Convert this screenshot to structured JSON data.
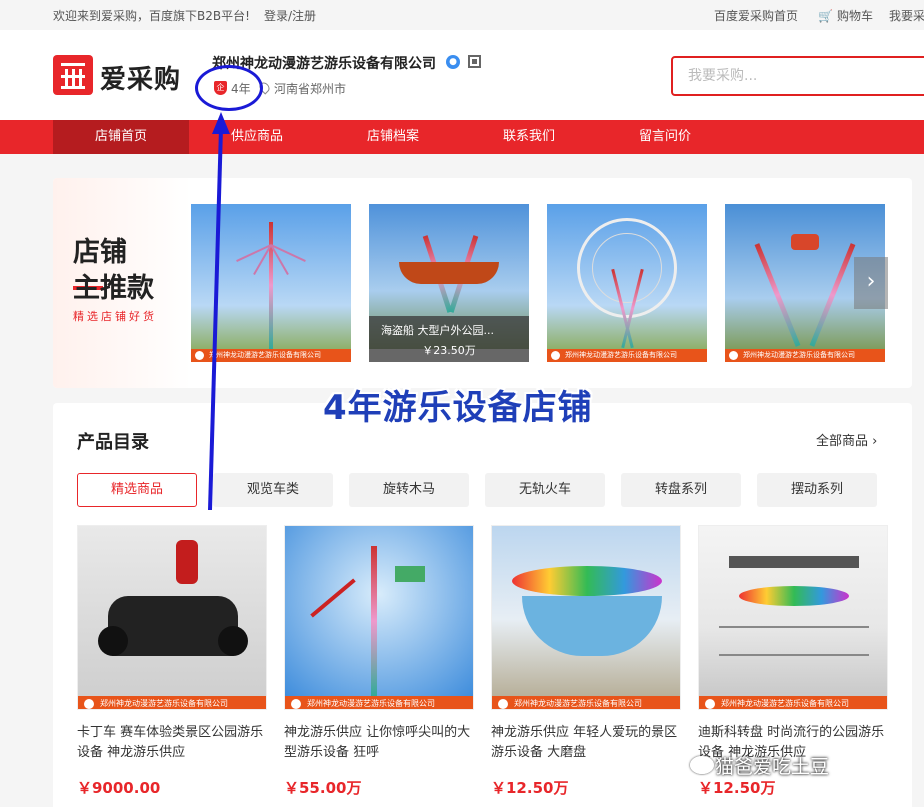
{
  "topbar": {
    "welcome": "欢迎来到爱采购，百度旗下B2B平台!",
    "login": "登录/注册",
    "home": "百度爱采购首页",
    "cart": "购物车",
    "more": "我要采购"
  },
  "header": {
    "logo_text": "爱采购",
    "shop_name": "郑州神龙动漫游艺游乐设备有限公司",
    "years": "4年",
    "location": "河南省郑州市",
    "search_placeholder": "我要采购..."
  },
  "nav": {
    "items": [
      {
        "label": "店铺首页"
      },
      {
        "label": "供应商品"
      },
      {
        "label": "店铺档案"
      },
      {
        "label": "联系我们"
      },
      {
        "label": "留言问价"
      }
    ]
  },
  "featured": {
    "title_line1": "店铺",
    "title_line2": "主推款",
    "subtitle": "精选店铺好货",
    "strip_text": "郑州神龙动漫游艺游乐设备有限公司",
    "overlay_title": "海盗船 大型户外公园...",
    "overlay_price": "￥23.50万",
    "next_label": "›"
  },
  "catalog": {
    "title": "产品目录",
    "all_link": "全部商品 ›",
    "tabs": [
      "精选商品",
      "观览车类",
      "旋转木马",
      "无轨火车",
      "转盘系列",
      "摆动系列"
    ],
    "products": [
      {
        "name": "卡丁车 赛车体验类景区公园游乐设备 神龙游乐供应",
        "price": "￥9000.00"
      },
      {
        "name": "神龙游乐供应 让你惊呼尖叫的大型游乐设备 狂呼",
        "price": "￥55.00万"
      },
      {
        "name": "神龙游乐供应 年轻人爱玩的景区游乐设备 大磨盘",
        "price": "￥12.50万"
      },
      {
        "name": "迪斯科转盘 时尚流行的公园游乐设备 神龙游乐供应",
        "price": "￥12.50万"
      }
    ],
    "strip_text": "郑州神龙动漫游艺游乐设备有限公司"
  },
  "annotation": {
    "text": "4年游乐设备店铺",
    "watermark": "猫爸爱吃土豆"
  }
}
